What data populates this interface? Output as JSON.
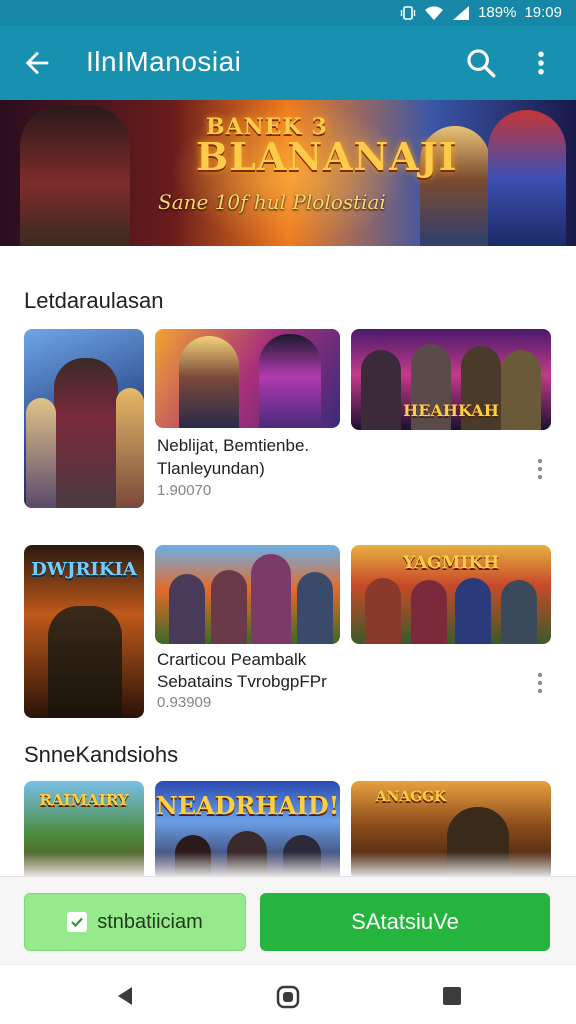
{
  "status_bar": {
    "battery": "189%",
    "time": "19:09"
  },
  "app_bar": {
    "title": "IlnIManosiai",
    "icons": [
      "back-arrow-icon",
      "search-icon",
      "more-vert-icon"
    ]
  },
  "banner": {
    "title": "BLANANAJI",
    "title_top": "BANEK 3",
    "subtitle": "Sane 10f hul Plolostiai"
  },
  "sections": [
    {
      "title": "Letdaraulasan"
    },
    {
      "title": "SnneKandsiohs"
    }
  ],
  "row1": {
    "thumbs": [
      "",
      "",
      "HEAHKAH"
    ],
    "item_title": "Neblijat, Bemtienbe.",
    "item_subtitle": "Tlanleyundan)",
    "rating": "1.90070"
  },
  "row2": {
    "thumbs": [
      "DWJRIKIA",
      "",
      "YAGMIKH"
    ],
    "item_title": "Crarticou Peambalk",
    "item_subtitle": "Sebatains TvrobgpFPr",
    "rating": "0.93909"
  },
  "row3": {
    "thumbs": [
      "RAIMAIRY",
      "NEADRHAID!",
      "ANAGGK"
    ]
  },
  "actions": {
    "secondary_label": "stnbatiiciam",
    "primary_label": "SAtatsiuVe"
  },
  "colors": {
    "appbar": "#1890b0",
    "primary": "#25b43e",
    "secondary": "#96ea8c"
  }
}
